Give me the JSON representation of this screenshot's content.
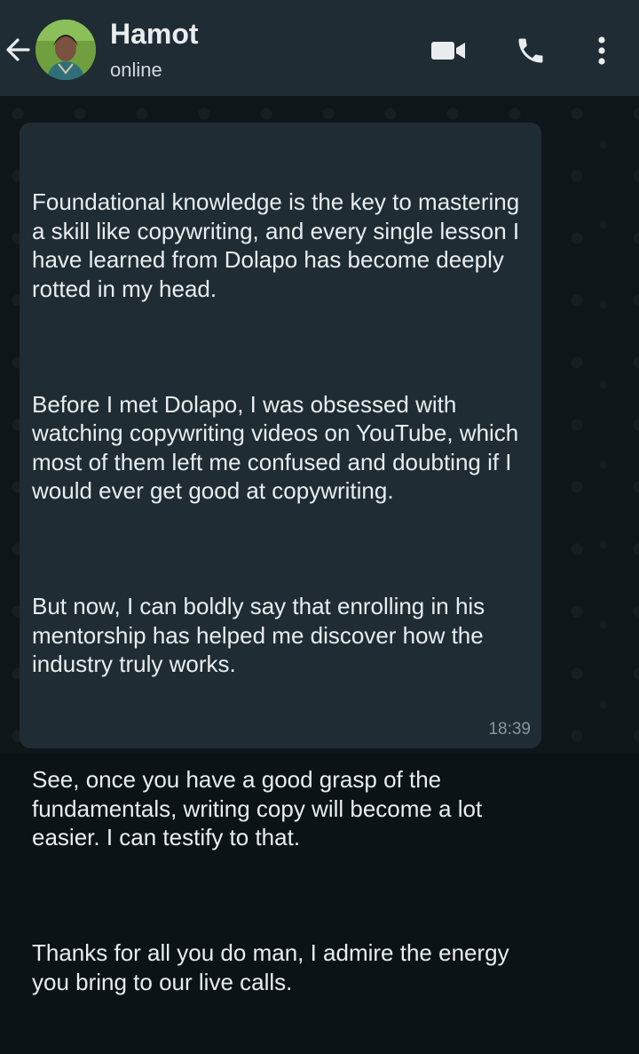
{
  "header": {
    "contact_name": "Hamot",
    "status": "online"
  },
  "icons": {
    "back": "arrow-left-icon",
    "video": "video-camera-icon",
    "call": "phone-icon",
    "menu": "more-vertical-icon"
  },
  "message": {
    "paragraphs": [
      "Foundational knowledge is the key to mastering a skill like copywriting, and every single lesson I have learned from Dolapo has become deeply rotted in my head.",
      "Before I met Dolapo, I was obsessed with watching copywriting videos on YouTube, which most of them left me confused and doubting if I would ever get good at copywriting.",
      "But now, I can boldly say that enrolling in his mentorship has helped me discover how the industry truly works.",
      "See, once you have a good grasp of the fundamentals, writing copy will become a lot easier. I can testify to that.",
      "Thanks for all you do man, I admire the energy you bring to our live calls."
    ],
    "time": "18:39"
  },
  "colors": {
    "header_bg": "#1f2c34",
    "bubble_bg": "#1f2c34",
    "chat_bg": "#0e1619",
    "text": "#e9edef",
    "meta_text": "#8696a0"
  }
}
